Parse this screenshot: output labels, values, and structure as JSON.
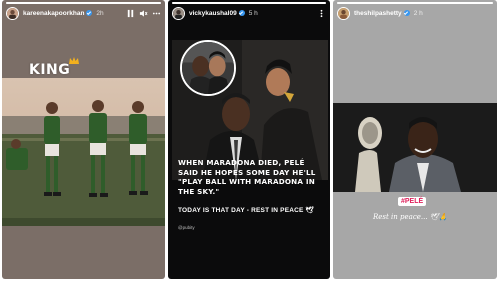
{
  "stories": [
    {
      "username": "kareenakapoorkhan",
      "time": "2h",
      "progress": 1.0,
      "overlay_text": "KING",
      "icons": [
        "pause-icon",
        "mute-icon",
        "more-icon"
      ]
    },
    {
      "username": "vickykaushal09",
      "time": "5 h",
      "progress": 1.0,
      "caption": "WHEN MARADONA DIED, PELÉ SAID HE HOPES SOME DAY HE'LL \"PLAY BALL WITH MARADONA IN THE SKY.\"",
      "caption_sub": "TODAY IS THAT DAY - REST IN PEACE 🕊",
      "credit": "@pubity",
      "icons": [
        "more-icon"
      ]
    },
    {
      "username": "theshilpashetty",
      "time": "2 h",
      "progress": 1.0,
      "tag": "#PELÉ",
      "message": "Rest in peace... 🕊🙏",
      "icons": []
    }
  ],
  "colors": {
    "verified_blue": "#3897f0",
    "crown_gold": "#f2b01e",
    "tag_pink": "#e0245e"
  }
}
